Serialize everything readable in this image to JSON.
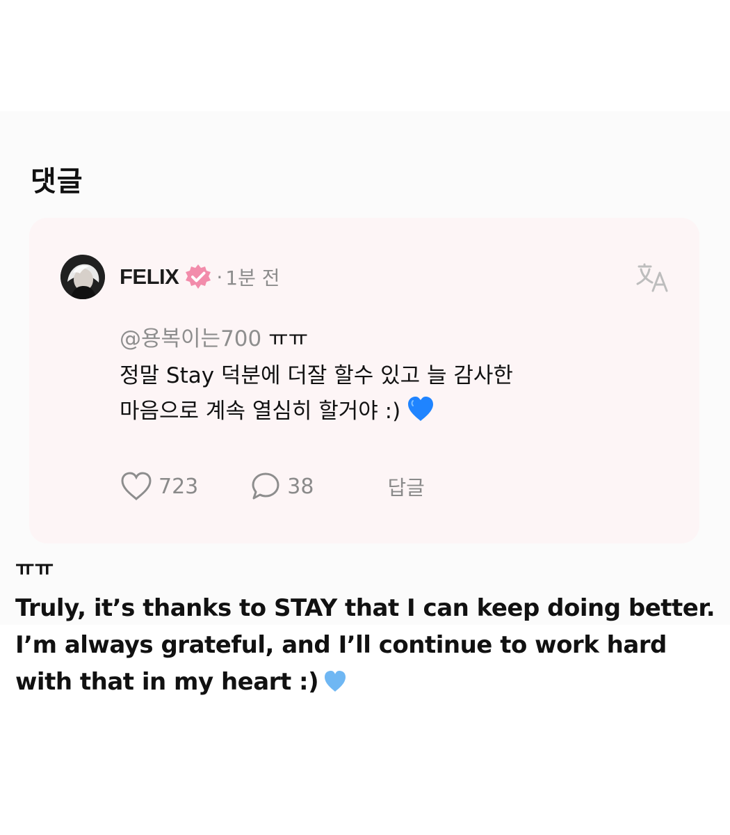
{
  "section": {
    "title": "댓글"
  },
  "comment": {
    "author": "FELIX",
    "separator": "·",
    "time": "1분 전",
    "mention": "@용복이는700",
    "mention_suffix": "ㅠㅠ",
    "body": "정말 Stay 덕분에 더잘 할수 있고 늘 감사한\n마음으로 계속 열심히 할거야 :)",
    "heart_emoji": "blue-heart-emoji",
    "likes": "723",
    "replies": "38",
    "reply_label": "답글",
    "verified_color": "#f28cab"
  },
  "icons": {
    "verified": "verified-badge-icon",
    "translate": "translate-icon",
    "like": "heart-outline-icon",
    "comment": "comment-bubble-icon"
  },
  "translation": {
    "prefix": "ㅠㅠ",
    "text": "Truly, it’s thanks to STAY that I can keep doing better.\nI’m always grateful, and I’ll continue to work hard\nwith that in my heart :)",
    "heart_emoji": "light-blue-heart-emoji"
  },
  "colors": {
    "card_background": "#fdf5f6",
    "muted_text": "#8c8c8c",
    "blue_heart": "#1f84ff",
    "light_blue_heart": "#6fb7f3"
  }
}
